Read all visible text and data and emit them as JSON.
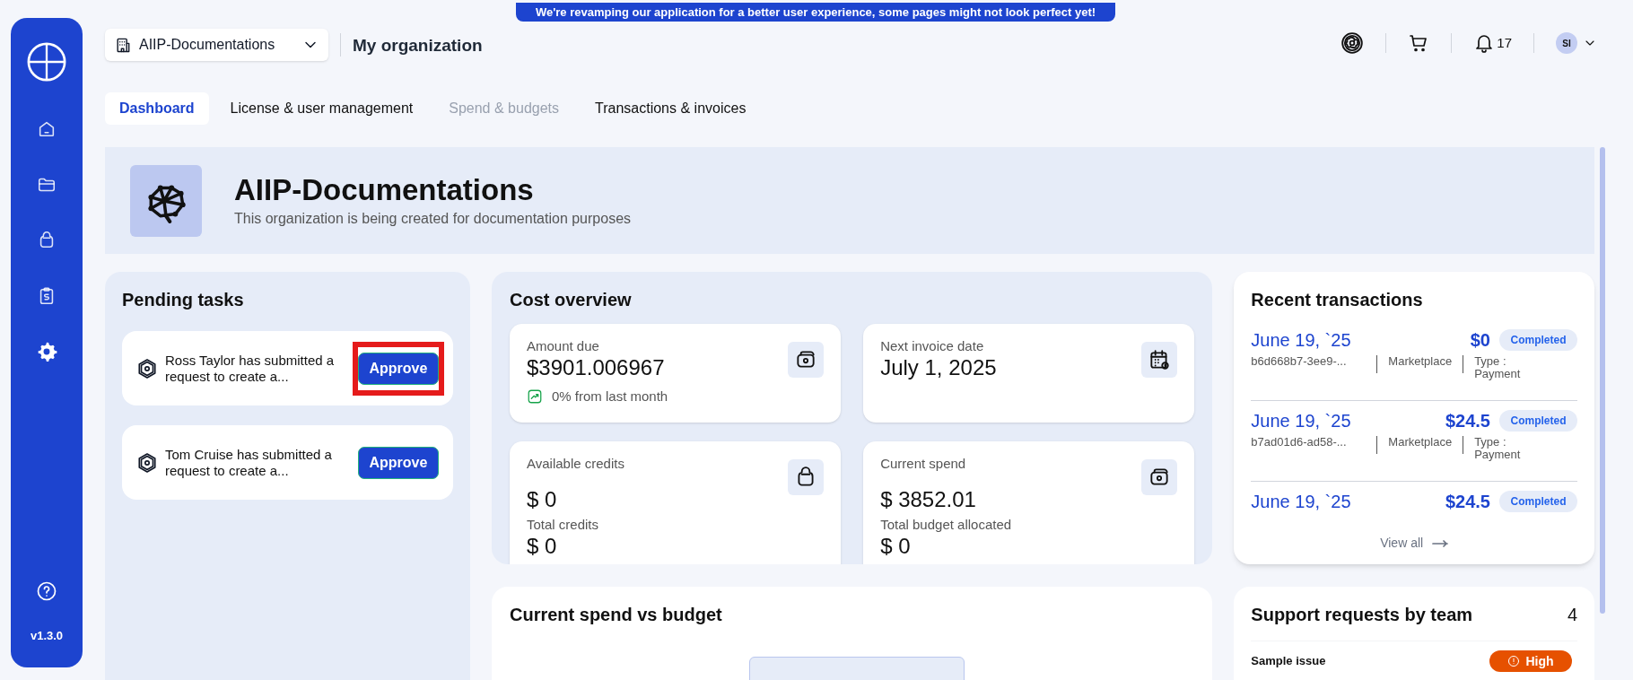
{
  "banner": "We're revamping our application for a better user experience, some pages might not look perfect yet!",
  "sidebar": {
    "items": [
      {
        "selected": false
      },
      {
        "selected": false
      },
      {
        "selected": false
      },
      {
        "selected": false
      },
      {
        "selected": true
      }
    ],
    "version": "v1.3.0"
  },
  "org_selector": {
    "value": "AIIP-Documentations"
  },
  "page_title": "My organization",
  "header_actions": {
    "notifications": "17",
    "avatar": "SI"
  },
  "tabs": [
    {
      "label": "Dashboard",
      "selected": true,
      "disabled": false
    },
    {
      "label": "License & user management",
      "selected": false,
      "disabled": false
    },
    {
      "label": "Spend & budgets",
      "selected": false,
      "disabled": true
    },
    {
      "label": "Transactions & invoices",
      "selected": false,
      "disabled": false
    }
  ],
  "org": {
    "name": "AIIP-Documentations",
    "description": "This organization is being created for documentation purposes"
  },
  "pending_tasks": {
    "title": "Pending tasks",
    "items": [
      {
        "text": "Ross Taylor has submitted a request to create a...",
        "button": "Approve",
        "highlighted": true
      },
      {
        "text": "Tom Cruise has submitted a request to create a...",
        "button": "Approve",
        "highlighted": false
      }
    ]
  },
  "cost_overview": {
    "title": "Cost overview",
    "cards": [
      {
        "kind": "trend",
        "label": "Amount due",
        "value": "$3901.006967",
        "note": "0% from last month"
      },
      {
        "kind": "plain",
        "label": "Next invoice date",
        "value": "July 1, 2025"
      },
      {
        "kind": "split",
        "label": "Available credits",
        "value": "$ 0",
        "label2": "Total credits",
        "value2": "$ 0"
      },
      {
        "kind": "split",
        "label": "Current spend",
        "value": "$ 3852.01",
        "label2": "Total budget allocated",
        "value2": "$ 0"
      }
    ]
  },
  "spend_vs_budget": {
    "title": "Current spend vs budget"
  },
  "recent_transactions": {
    "title": "Recent transactions",
    "items": [
      {
        "date": "June 19, `25",
        "amount": "$0",
        "status": "Completed",
        "id": "b6d668b7-3ee9-...",
        "source": "Marketplace",
        "type": "Type : Payment"
      },
      {
        "date": "June 19, `25",
        "amount": "$24.5",
        "status": "Completed",
        "id": "b7ad01d6-ad58-...",
        "source": "Marketplace",
        "type": "Type : Payment"
      },
      {
        "date": "June 19, `25",
        "amount": "$24.5",
        "status": "Completed"
      }
    ],
    "link": "View all"
  },
  "support_requests": {
    "title": "Support requests by team",
    "count": "4",
    "items": [
      {
        "title": "Sample issue",
        "priority": "High",
        "color": "#e65100"
      }
    ]
  }
}
